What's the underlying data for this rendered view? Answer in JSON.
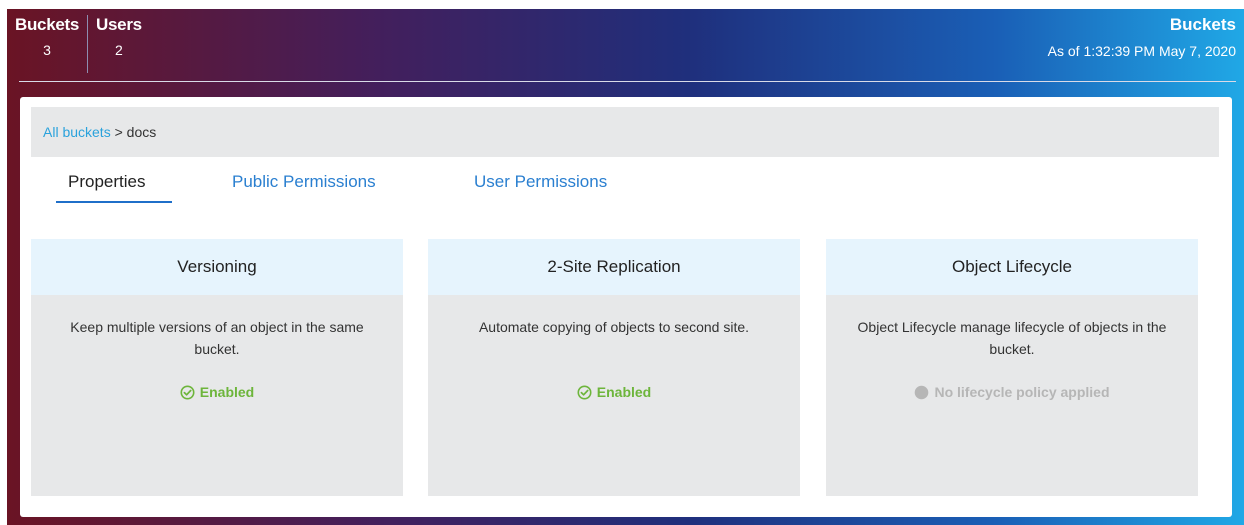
{
  "header": {
    "stats": [
      {
        "label": "Buckets",
        "value": "3"
      },
      {
        "label": "Users",
        "value": "2"
      }
    ],
    "title": "Buckets",
    "timestamp": "As of 1:32:39 PM May 7, 2020"
  },
  "breadcrumb": {
    "link": "All buckets",
    "separator": " > ",
    "current": "docs"
  },
  "tabs": [
    {
      "label": "Properties",
      "active": true
    },
    {
      "label": "Public Permissions",
      "active": false
    },
    {
      "label": "User Permissions",
      "active": false
    }
  ],
  "cards": [
    {
      "title": "Versioning",
      "description": "Keep multiple versions of an object in the same bucket.",
      "status": "Enabled",
      "status_icon": "check-circle-icon",
      "status_color": "#6db53b"
    },
    {
      "title": "2-Site Replication",
      "description": "Automate copying of objects to second site.",
      "status": "Enabled",
      "status_icon": "check-circle-icon",
      "status_color": "#6db53b"
    },
    {
      "title": "Object Lifecycle",
      "description": "Object Lifecycle manage lifecycle of objects in the bucket.",
      "status": "No lifecycle policy applied",
      "status_icon": "filled-circle-icon",
      "status_color": "#b6b6b6"
    }
  ],
  "colors": {
    "accent": "#2aa2dc",
    "tab_link": "#2a7fd0",
    "enabled": "#6db53b",
    "disabled": "#b6b6b6",
    "card_header": "#e6f4fd",
    "card_body": "#e7e8e9"
  }
}
